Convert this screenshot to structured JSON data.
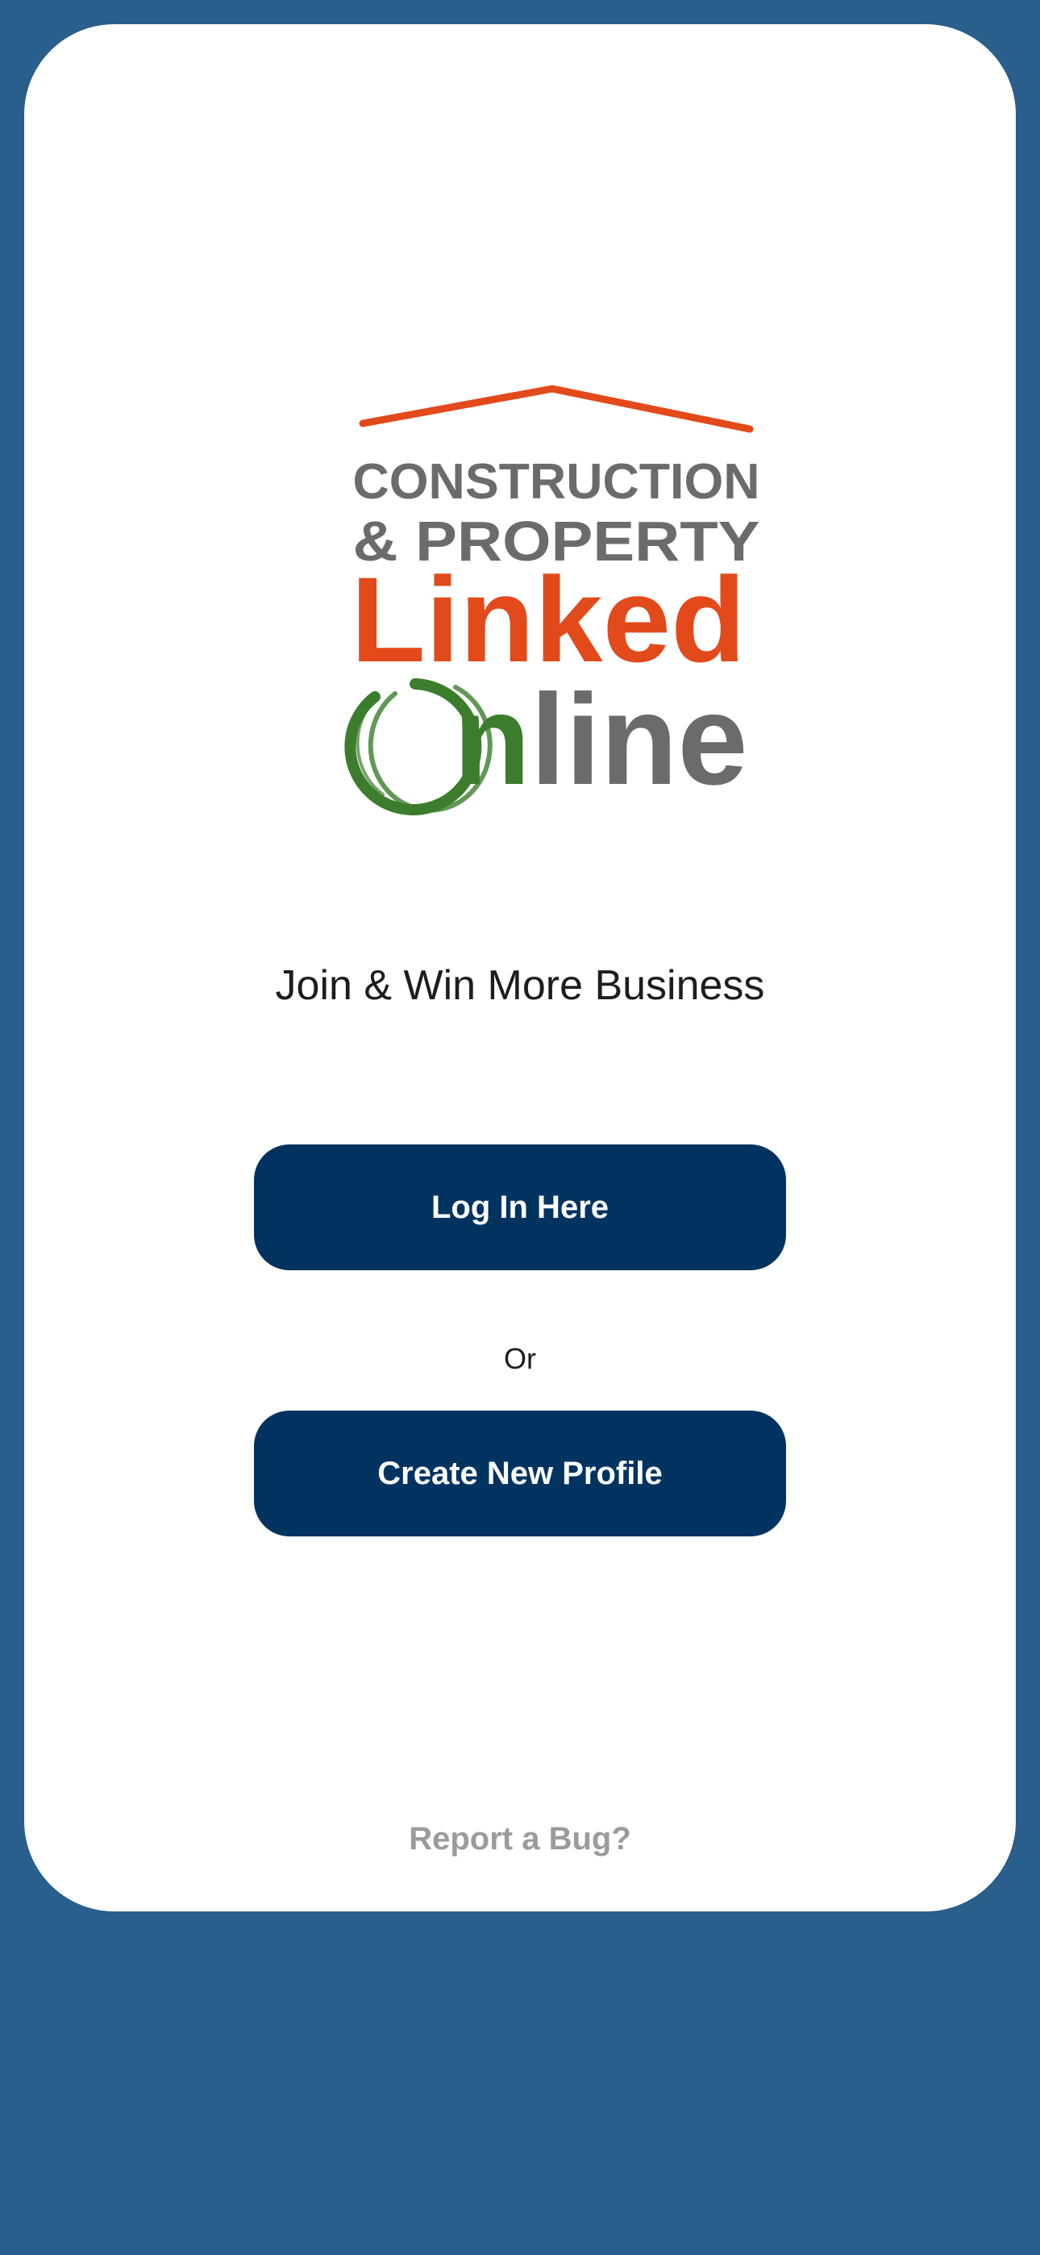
{
  "logo": {
    "line1": "CONSTRUCTION",
    "line2": "& PROPERTY",
    "line3": "Linked",
    "line4": "nline",
    "colors": {
      "roof": "#e24a1b",
      "grey": "#6b6b6b",
      "orange": "#e24a1b",
      "green": "#3b7d2c"
    }
  },
  "tagline": "Join & Win More Business",
  "buttons": {
    "login_label": "Log In Here",
    "or_label": "Or",
    "create_label": "Create New Profile"
  },
  "footer": {
    "bug_label": "Report a Bug?"
  },
  "colors": {
    "background": "#2a5e8c",
    "card": "#ffffff",
    "button": "#013361",
    "muted": "#9b9b9b"
  }
}
